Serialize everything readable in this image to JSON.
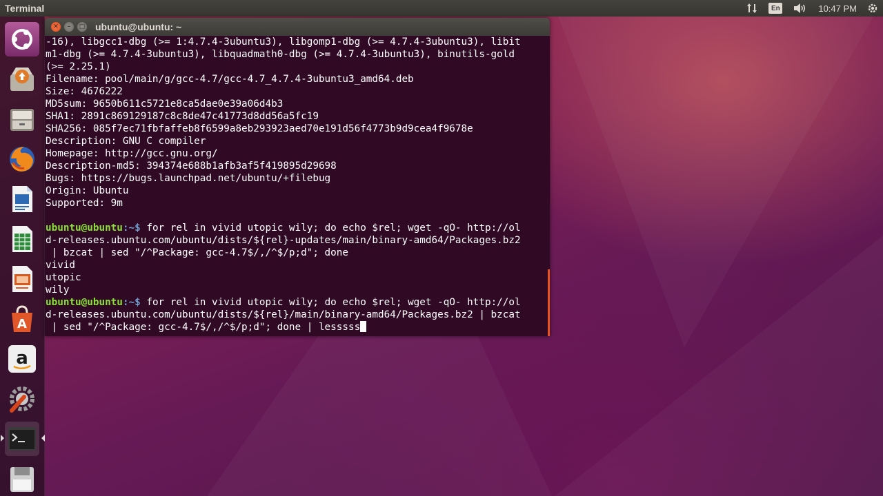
{
  "panel": {
    "app_name": "Terminal",
    "keyboard_layout": "En",
    "clock": "10:47 PM"
  },
  "launcher": {
    "items": [
      {
        "name": "Ubuntu Dash",
        "icon": "ubuntu-logo-icon"
      },
      {
        "name": "System Settings Updater",
        "icon": "software-updater-icon"
      },
      {
        "name": "Files",
        "icon": "file-cabinet-icon"
      },
      {
        "name": "Firefox",
        "icon": "firefox-icon"
      },
      {
        "name": "LibreOffice Writer",
        "icon": "writer-document-icon"
      },
      {
        "name": "LibreOffice Calc",
        "icon": "calc-spreadsheet-icon"
      },
      {
        "name": "LibreOffice Impress",
        "icon": "impress-presentation-icon"
      },
      {
        "name": "Ubuntu Software",
        "icon": "software-center-icon"
      },
      {
        "name": "Amazon",
        "icon": "amazon-icon"
      },
      {
        "name": "System Settings",
        "icon": "wrench-settings-icon"
      },
      {
        "name": "Terminal",
        "icon": "terminal-icon",
        "active": true
      },
      {
        "name": "Floppy / Save",
        "icon": "floppy-disk-icon"
      }
    ]
  },
  "window": {
    "title": "ubuntu@ubuntu: ~",
    "prompt_user": "ubuntu@ubuntu",
    "prompt_path": ":~$",
    "lines": [
      {
        "type": "text",
        "text": "-16), libgcc1-dbg (>= 1:4.7.4-3ubuntu3), libgomp1-dbg (>= 4.7.4-3ubuntu3), libit"
      },
      {
        "type": "text",
        "text": "m1-dbg (>= 4.7.4-3ubuntu3), libquadmath0-dbg (>= 4.7.4-3ubuntu3), binutils-gold"
      },
      {
        "type": "text",
        "text": "(>= 2.25.1)"
      },
      {
        "type": "text",
        "text": "Filename: pool/main/g/gcc-4.7/gcc-4.7_4.7.4-3ubuntu3_amd64.deb"
      },
      {
        "type": "text",
        "text": "Size: 4676222"
      },
      {
        "type": "text",
        "text": "MD5sum: 9650b611c5721e8ca5dae0e39a06d4b3"
      },
      {
        "type": "text",
        "text": "SHA1: 2891c869129187c8c8de47c41773d8dd56a5fc19"
      },
      {
        "type": "text",
        "text": "SHA256: 085f7ec71fbfaffeb8f6599a8eb293923aed70e191d56f4773b9d9cea4f9678e"
      },
      {
        "type": "text",
        "text": "Description: GNU C compiler"
      },
      {
        "type": "text",
        "text": "Homepage: http://gcc.gnu.org/"
      },
      {
        "type": "text",
        "text": "Description-md5: 394374e688b1afb3af5f419895d29698"
      },
      {
        "type": "text",
        "text": "Bugs: https://bugs.launchpad.net/ubuntu/+filebug"
      },
      {
        "type": "text",
        "text": "Origin: Ubuntu"
      },
      {
        "type": "text",
        "text": "Supported: 9m"
      },
      {
        "type": "text",
        "text": ""
      },
      {
        "type": "prompt",
        "text": " for rel in vivid utopic wily; do echo $rel; wget -qO- http://ol"
      },
      {
        "type": "text",
        "text": "d-releases.ubuntu.com/ubuntu/dists/${rel}-updates/main/binary-amd64/Packages.bz2"
      },
      {
        "type": "text",
        "text": " | bzcat | sed \"/^Package: gcc-4.7$/,/^$/p;d\"; done"
      },
      {
        "type": "text",
        "text": "vivid"
      },
      {
        "type": "text",
        "text": "utopic"
      },
      {
        "type": "text",
        "text": "wily"
      },
      {
        "type": "prompt",
        "text": " for rel in vivid utopic wily; do echo $rel; wget -qO- http://ol"
      },
      {
        "type": "text",
        "text": "d-releases.ubuntu.com/ubuntu/dists/${rel}/main/binary-amd64/Packages.bz2 | bzcat"
      },
      {
        "type": "current",
        "text": " | sed \"/^Package: gcc-4.7$/,/^$/p;d\"; done | lesssss"
      }
    ]
  }
}
